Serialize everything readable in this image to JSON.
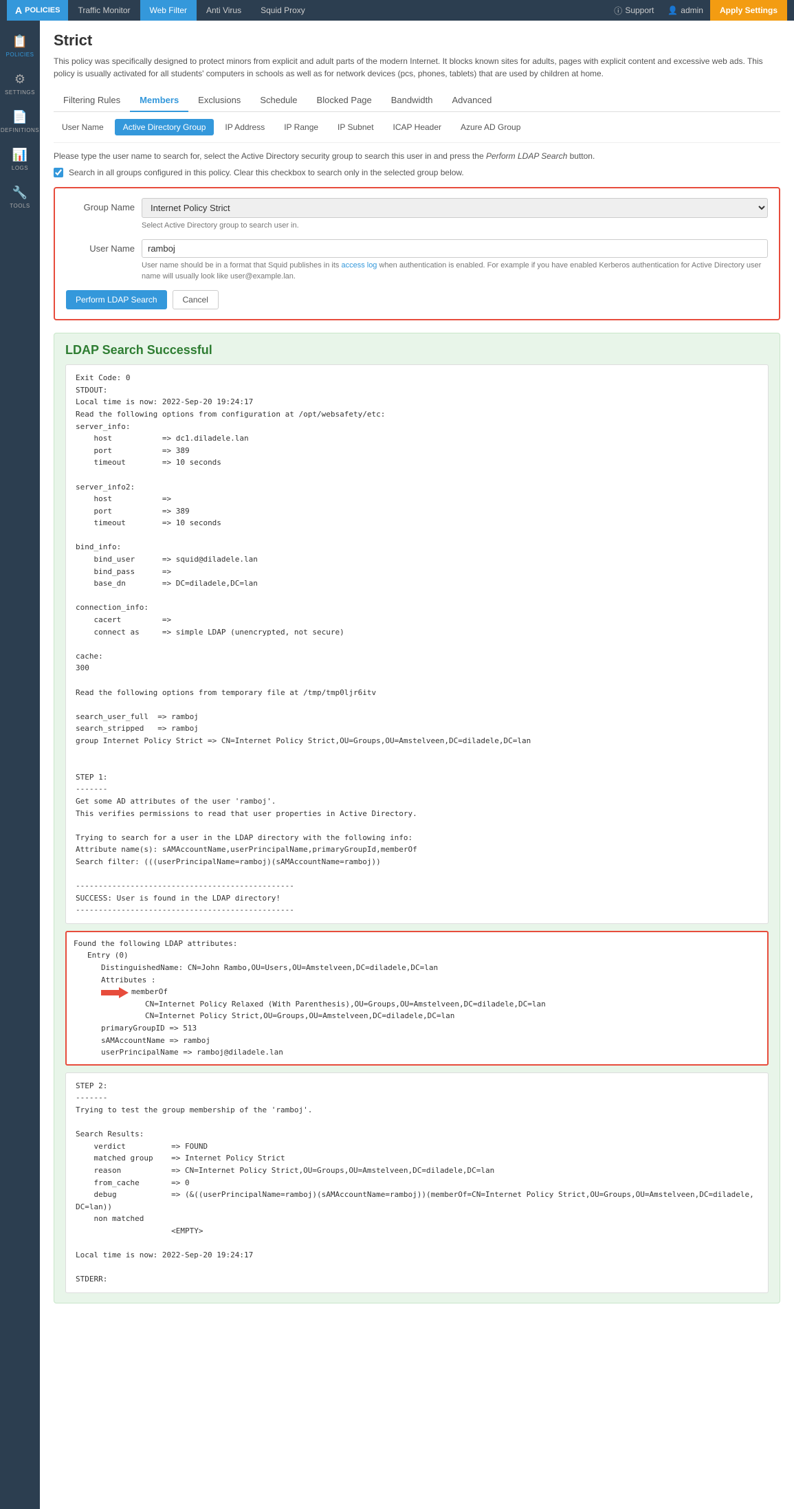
{
  "topnav": {
    "brand_icon": "A",
    "brand_label": "POLICIES",
    "items": [
      {
        "label": "Traffic Monitor",
        "active": false
      },
      {
        "label": "Web Filter",
        "active": true
      },
      {
        "label": "Anti Virus",
        "active": false
      },
      {
        "label": "Squid Proxy",
        "active": false
      }
    ],
    "support_label": "Support",
    "user_label": "admin",
    "apply_label": "Apply Settings"
  },
  "sidebar": {
    "items": [
      {
        "icon": "📋",
        "label": "POLICIES",
        "active": true
      },
      {
        "icon": "⚙",
        "label": "SETTINGS",
        "active": false
      },
      {
        "icon": "📄",
        "label": "DEFINITIONS",
        "active": false
      },
      {
        "icon": "📊",
        "label": "LOGS",
        "active": false
      },
      {
        "icon": "🔧",
        "label": "TOOLS",
        "active": false
      }
    ]
  },
  "page": {
    "title": "Strict",
    "description": "This policy was specifically designed to protect minors from explicit and adult parts of the modern Internet. It blocks known sites for adults, pages with explicit content and excessive web ads. This policy is usually activated for all students' computers in schools as well as for network devices (pcs, phones, tablets) that are used by children at home."
  },
  "tabs": {
    "items": [
      {
        "label": "Filtering Rules",
        "active": false
      },
      {
        "label": "Members",
        "active": true
      },
      {
        "label": "Exclusions",
        "active": false
      },
      {
        "label": "Schedule",
        "active": false
      },
      {
        "label": "Blocked Page",
        "active": false
      },
      {
        "label": "Bandwidth",
        "active": false
      },
      {
        "label": "Advanced",
        "active": false
      }
    ]
  },
  "sub_tabs": {
    "items": [
      {
        "label": "User Name",
        "active": false
      },
      {
        "label": "Active Directory Group",
        "active": true
      },
      {
        "label": "IP Address",
        "active": false
      },
      {
        "label": "IP Range",
        "active": false
      },
      {
        "label": "IP Subnet",
        "active": false
      },
      {
        "label": "ICAP Header",
        "active": false
      },
      {
        "label": "Azure AD Group",
        "active": false
      }
    ]
  },
  "search_section": {
    "info_text": "Please type the user name to search for, select the Active Directory security group to search this user in and press the",
    "info_italic": "Perform LDAP Search",
    "info_suffix": "button.",
    "checkbox_label": "Search in all groups configured in this policy. Clear this checkbox to search only in the selected group below.",
    "group_name_label": "Group Name",
    "group_name_value": "Internet Policy Strict",
    "group_name_hint": "Select Active Directory group to search user in.",
    "user_name_label": "User Name",
    "user_name_value": "ramboj",
    "user_name_hint": "User name should be in a format that Squid publishes in its",
    "user_name_hint_link": "access log",
    "user_name_hint_suffix": "when authentication is enabled. For example if you have enabled Kerberos authentication for Active Directory user name will usually look like user@example.lan.",
    "perform_btn": "Perform LDAP Search",
    "cancel_btn": "Cancel"
  },
  "ldap_result": {
    "title": "LDAP Search Successful",
    "output_part1": "Exit Code: 0\nSTDOUT:\nLocal time is now: 2022-Sep-20 19:24:17\nRead the following options from configuration at /opt/websafety/etc:\nserver_info:\n    host           => dc1.diladele.lan\n    port           => 389\n    timeout        => 10 seconds\n\nserver_info2:\n    host           =>\n    port           => 389\n    timeout        => 10 seconds\n\nbind_info:\n    bind_user      => squid@diladele.lan\n    bind_pass      =>\n    base_dn        => DC=diladele,DC=lan\n\nconnection_info:\n    cacert         =>\n    connect as     => simple LDAP (unencrypted, not secure)\n\ncache:\n300\n\nRead the following options from temporary file at /tmp/tmp0ljr6itv\n\nsearch_user_full  => ramboj\nsearch_stripped   => ramboj\ngroup Internet Policy Strict => CN=Internet Policy Strict,OU=Groups,OU=Amstelveen,DC=diladele,DC=lan\n\n\nSTEP 1:\n-------\nGet some AD attributes of the user 'ramboj'.\nThis verifies permissions to read that user properties in Active Directory.\n\nTrying to search for a user in the LDAP directory with the following info:\nAttribute name(s): sAMAccountName,userPrincipalName,primaryGroupId,memberOf\nSearch filter: (((userPrincipalName=ramboj)(sAMAccountName=ramboj))\n\n------------------------------------------------\nSUCCESS: User is found in the LDAP directory!\n------------------------------------------------",
    "highlight_box": {
      "line1": "Found the following LDAP attributes:",
      "line2": "    Entry (0)",
      "line3": "        DistinguishedName: CN=John Rambo,OU=Users,OU=Amstelveen,DC=diladele,DC=lan",
      "line4": "        Attributes      :",
      "line5_label": "            memberOf",
      "line6": "                CN=Internet Policy Relaxed (With Parenthesis),OU=Groups,OU=Amstelveen,DC=diladele,DC=lan",
      "line7": "                CN=Internet Policy Strict,OU=Groups,OU=Amstelveen,DC=diladele,DC=lan",
      "line8": "        primaryGroupID => 513",
      "line9": "        sAMAccountName => ramboj",
      "line10": "        userPrincipalName => ramboj@diladele.lan"
    },
    "output_part2": "STEP 2:\n-------\nTrying to test the group membership of the 'ramboj'.\n\nSearch Results:\n    verdict          => FOUND\n    matched group    => Internet Policy Strict\n    reason           => CN=Internet Policy Strict,OU=Groups,OU=Amstelveen,DC=diladele,DC=lan\n    from_cache       => 0\n    debug            => (&((userPrincipalName=ramboj)(sAMAccountName=ramboj))(memberOf=CN=Internet Policy Strict,OU=Groups,OU=Amstelveen,DC=diladele,DC=lan))\n    non matched\n                     <EMPTY>\n\nLocal time is now: 2022-Sep-20 19:24:17\n\nSTDERR:"
  }
}
